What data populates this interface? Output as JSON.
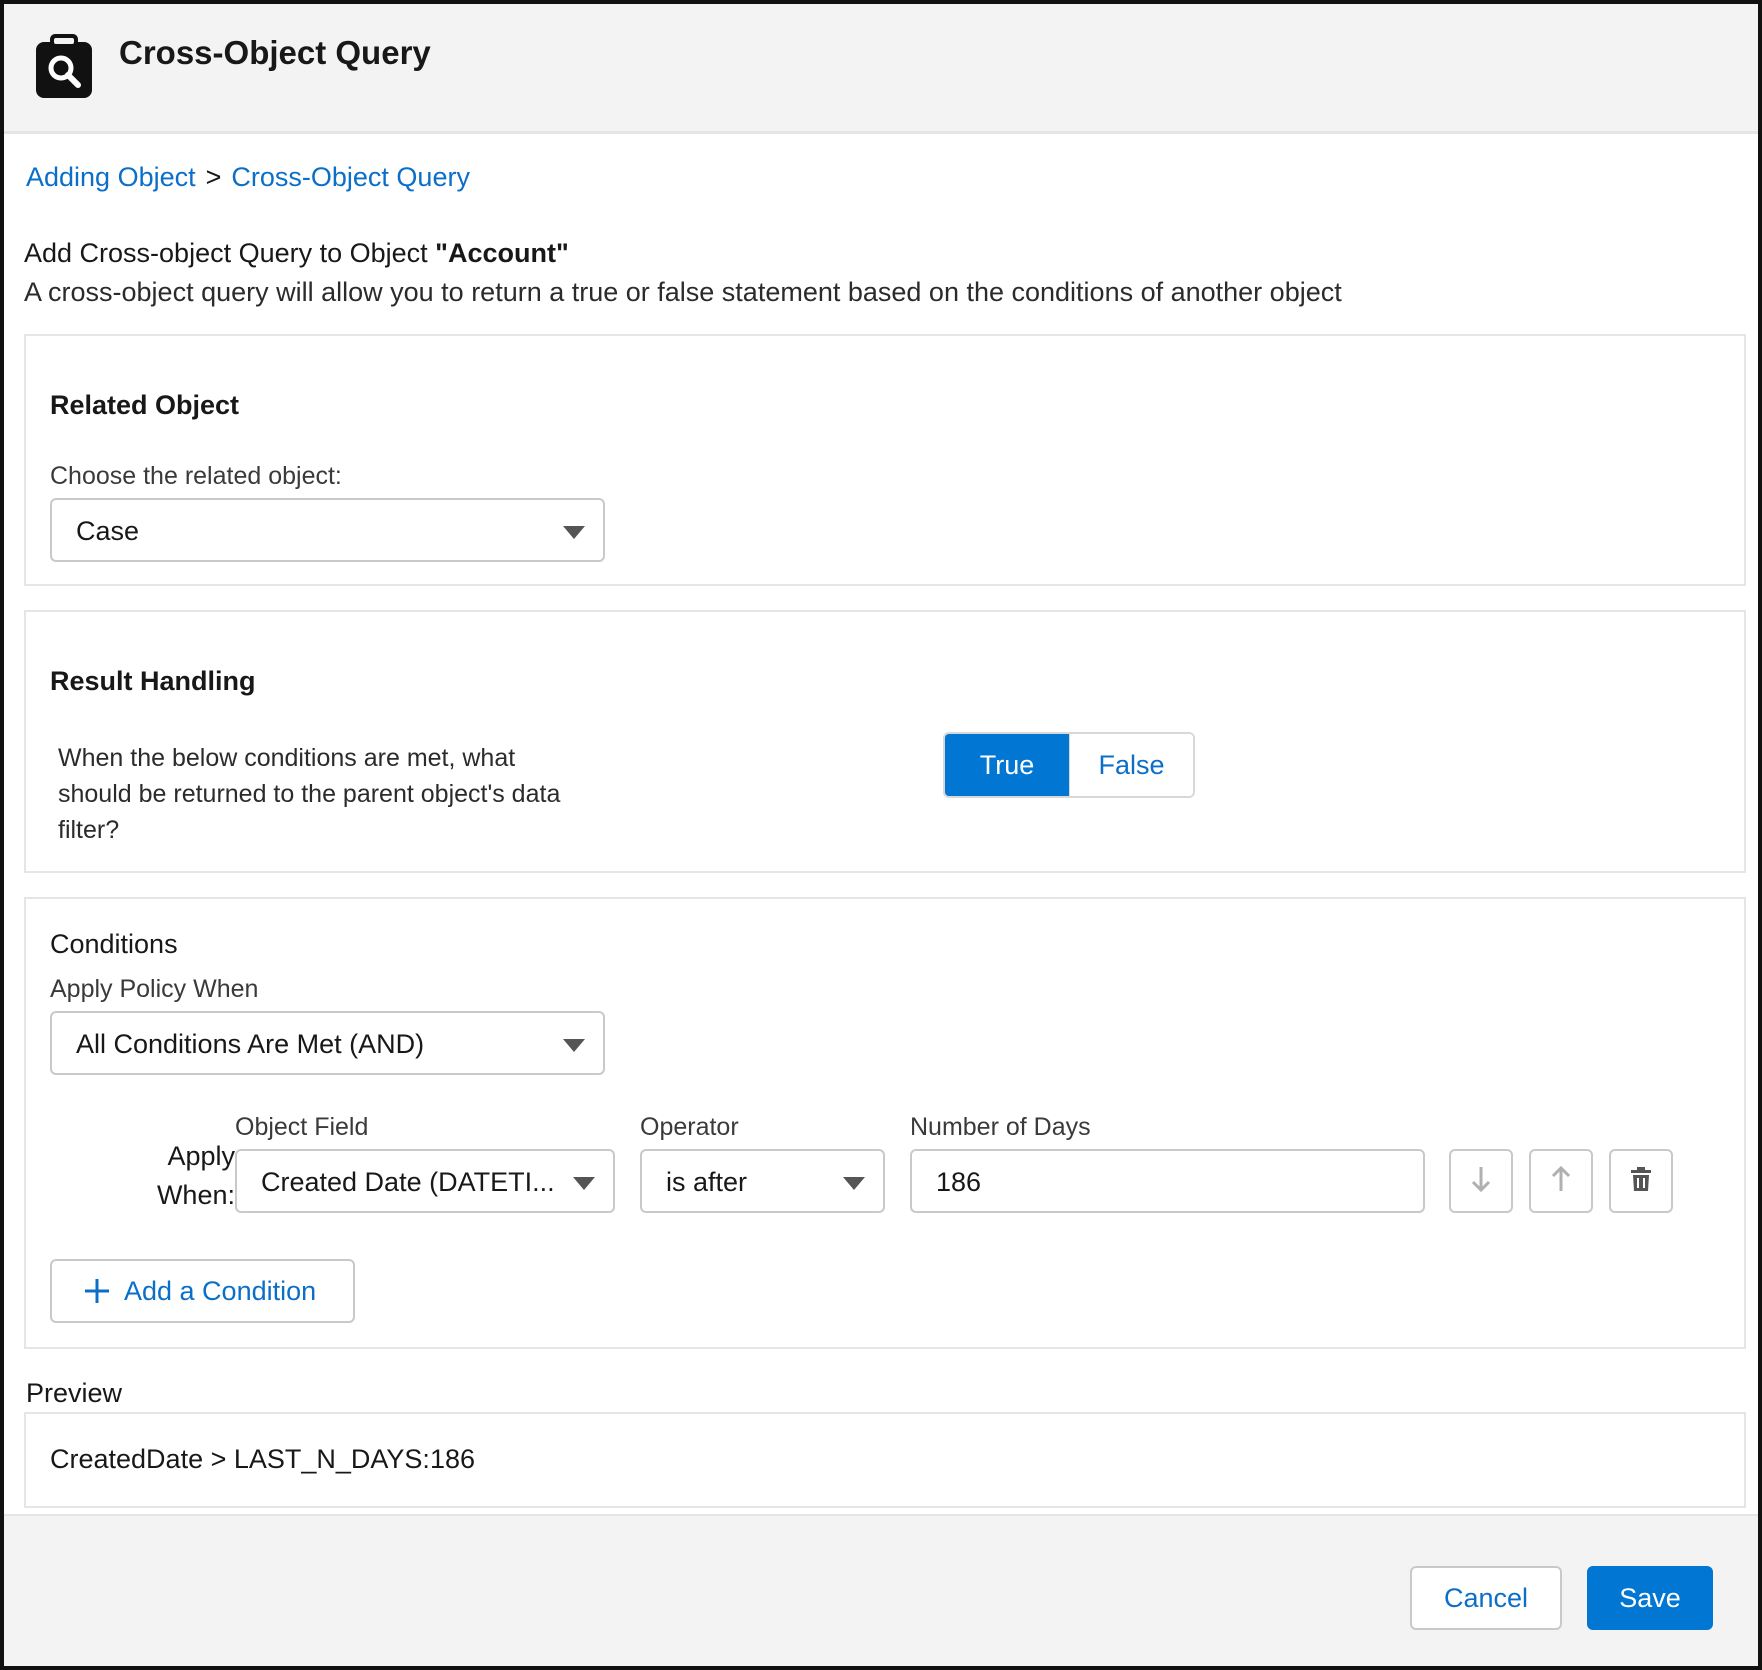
{
  "header": {
    "title": "Cross-Object Query",
    "icon": "clipboard-search-icon"
  },
  "breadcrumb": {
    "items": [
      "Adding Object",
      "Cross-Object Query"
    ],
    "separator": ">"
  },
  "intro": {
    "title_prefix": "Add Cross-object Query to Object ",
    "object_name": "\"Account\"",
    "description": "A cross-object query will allow you to return a true or false statement based on the conditions of another object"
  },
  "related_object": {
    "heading": "Related Object",
    "label": "Choose the related object:",
    "selected": "Case"
  },
  "result_handling": {
    "heading": "Result Handling",
    "description": "When the below conditions are met, what should be returned to the parent object's data filter?",
    "options": [
      "True",
      "False"
    ],
    "selected": "True"
  },
  "conditions": {
    "title": "Conditions",
    "policy_label": "Apply Policy When",
    "policy_selected": "All Conditions Are Met (AND)",
    "apply_when_line1": "Apply",
    "apply_when_line2": "When:",
    "columns": {
      "field": "Object Field",
      "operator": "Operator",
      "value": "Number of Days"
    },
    "rows": [
      {
        "field": "Created Date (DATETI...",
        "operator": "is after",
        "value": "186"
      }
    ],
    "add_label": "Add a Condition"
  },
  "preview": {
    "label": "Preview",
    "text": "CreatedDate > LAST_N_DAYS:186"
  },
  "footer": {
    "cancel_label": "Cancel",
    "save_label": "Save"
  },
  "colors": {
    "brand": "#0176d3",
    "link": "#0b6fc9",
    "header_bg": "#f3f3f3",
    "border": "#c9c9c9"
  }
}
